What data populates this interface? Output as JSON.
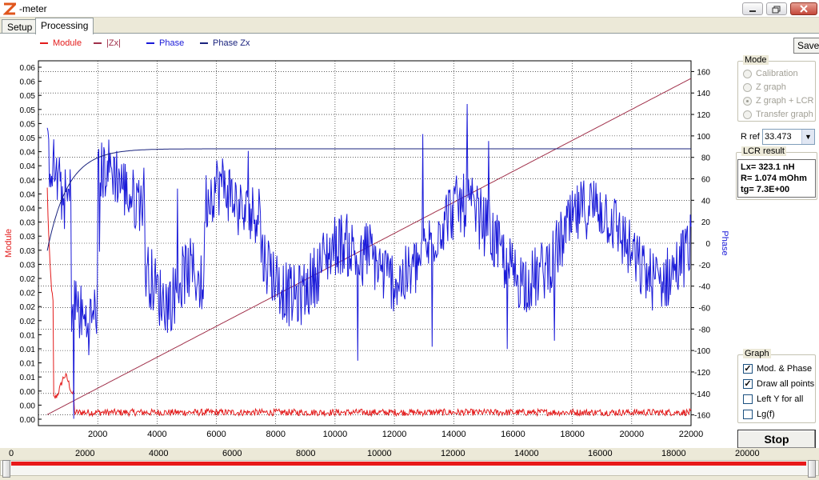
{
  "window": {
    "title": "-meter"
  },
  "tabs": [
    {
      "label": "Setup"
    },
    {
      "label": "Processing"
    }
  ],
  "legend": [
    {
      "label": "Module",
      "color": "#e31b1b"
    },
    {
      "label": "|Zx|",
      "color": "#a0304a"
    },
    {
      "label": "Phase",
      "color": "#1a1ad8"
    },
    {
      "label": "Phase Zx",
      "color": "#1a237e"
    }
  ],
  "toolbar": {
    "save_label": "Save"
  },
  "mode": {
    "title": "Mode",
    "options": [
      {
        "label": "Calibration",
        "checked": false
      },
      {
        "label": "Z graph",
        "checked": false
      },
      {
        "label": "Z graph + LCR",
        "checked": true
      },
      {
        "label": "Transfer graph",
        "checked": false
      }
    ]
  },
  "rref": {
    "label": "R ref",
    "value": "33.473"
  },
  "lcr": {
    "title": "LCR result",
    "line1": "Lx= 323.1 nH",
    "line2": "R= 1.074 mOhm",
    "line3": "tg= 7.3E+00"
  },
  "graph": {
    "title": "Graph",
    "options": [
      {
        "label": "Mod. & Phase",
        "checked": true
      },
      {
        "label": "Draw all points",
        "checked": true
      },
      {
        "label": "Left Y for all",
        "checked": false
      },
      {
        "label": "Lg(f)",
        "checked": false
      }
    ]
  },
  "stop_label": "Stop",
  "ruler": {
    "labels": [
      "0",
      "2000",
      "4000",
      "6000",
      "8000",
      "10000",
      "12000",
      "14000",
      "16000",
      "18000",
      "20000"
    ],
    "max": 20000
  },
  "chart_data": {
    "type": "line",
    "ylabel_left": "Module",
    "ylabel_right": "Phase",
    "xlim": [
      0,
      22000
    ],
    "x_ticks": [
      "2000",
      "4000",
      "6000",
      "8000",
      "10000",
      "12000",
      "14000",
      "16000",
      "18000",
      "20000",
      "22000"
    ],
    "left_ticks": [
      "0.06",
      "0.06",
      "0.05",
      "0.05",
      "0.05",
      "0.05",
      "0.04",
      "0.04",
      "0.04",
      "0.04",
      "0.04",
      "0.03",
      "0.03",
      "0.03",
      "0.03",
      "0.02",
      "0.02",
      "0.02",
      "0.02",
      "0.01",
      "0.01",
      "0.01",
      "0.01",
      "0.00",
      "0.00",
      "0.00"
    ],
    "right_ticks": [
      "160",
      "140",
      "120",
      "100",
      "80",
      "60",
      "40",
      "20",
      "0",
      "-20",
      "-40",
      "-60",
      "-80",
      "-100",
      "-120",
      "-140",
      "-160"
    ],
    "right_ylim": [
      -170,
      170
    ],
    "grid": true,
    "series": [
      {
        "name": "Module",
        "color": "#e31b1b",
        "profile": "module"
      },
      {
        "name": "|Zx|",
        "color": "#a0304a",
        "profile": "zx"
      },
      {
        "name": "Phase",
        "color": "#1a1ad8",
        "profile": "phase"
      },
      {
        "name": "Phase Zx",
        "color": "#1a237e",
        "profile": "phasezx"
      }
    ]
  }
}
